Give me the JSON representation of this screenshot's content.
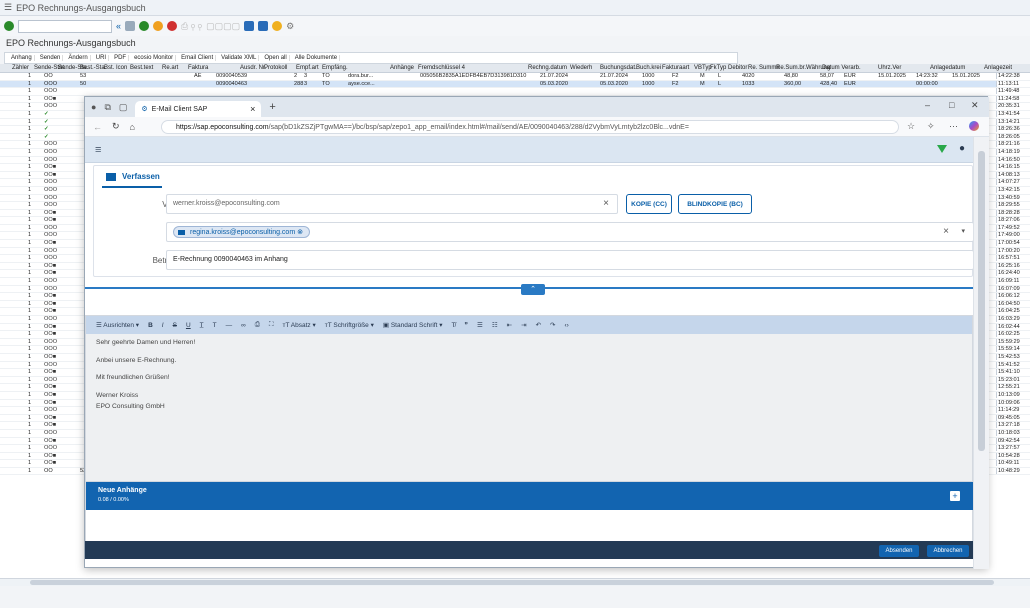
{
  "sap": {
    "window_title": "EPO Rechnungs-Ausgangsbuch",
    "page_title": "EPO Rechnungs-Ausgangsbuch",
    "toolbar_items": [
      "Anhang",
      "Senden",
      "Ändern",
      "URI",
      "PDF",
      "ecosio Monitor",
      "Email Client",
      "Validate XML",
      "Open all",
      "Alle Dokumente"
    ],
    "columns": [
      "Zähler",
      "Sende-Stat.",
      "Sende-Sta.",
      "Best.-Sta.",
      "Bst. Icon",
      "Best.text",
      "Re.art",
      "Faktura",
      "Ausdr. Nr.",
      "Protokoll",
      "Empf.art",
      "Empfäng.",
      "Anhänge",
      "Fremdschlüssel 4",
      "Rechng.datum",
      "Wiederh",
      "Buchungsdat.",
      "Buch.krei",
      "Fakturaart",
      "VBTyp",
      "FkTyp",
      "Debitor",
      "Re. Summe",
      "Re.Sum.br.",
      "Währung",
      "Datum Verarb.",
      "Uhrz.Ver",
      "Anlagedatum",
      "Anlagezeit"
    ],
    "rows": [
      {
        "z": "1",
        "s": "OO",
        "a": "53",
        "ar": "AE",
        "f": "0090040539",
        "n": "2",
        "p": "3",
        "e": "TO",
        "em": "dora.bur...",
        "k": "005056B2835A1EDFB4EB7D313981D310",
        "rd": "21.07.2024",
        "bd": "21.07.2024",
        "bk": "1000",
        "fa": "F2",
        "vb": "M",
        "fk": "L",
        "d": "4020",
        "rs": "48,80",
        "rb": "58,07",
        "w": "EUR",
        "dv": "15.01.2025",
        "uv": "14:23:32",
        "ad": "15.01.2025",
        "t": "14:22:38"
      },
      {
        "z": "1",
        "s": "OOO",
        "a": "50",
        "ar": "",
        "f": "0090040463",
        "n": "288",
        "p": "3",
        "e": "TO",
        "em": "ayse.cce...",
        "k": "",
        "rd": "05.03.2020",
        "bd": "05.03.2020",
        "bk": "1000",
        "fa": "F2",
        "vb": "M",
        "fk": "L",
        "d": "1033",
        "rs": "360,00",
        "rb": "428,40",
        "w": "EUR",
        "dv": "",
        "uv": "00:00:00",
        "ad": "",
        "t": "11:13:11"
      }
    ],
    "bottom_rows": [
      {
        "z": "1",
        "s": "OO",
        "a": "53",
        "n": "249",
        "p": "3",
        "e": "TO",
        "em": "customer...",
        "k": "005056B2835A1EDFA7892BF46CB3A96B",
        "rd": "05.03.2020",
        "bd": "05.03.2020",
        "bk": "1000",
        "fa": "F2",
        "vb": "M",
        "fk": "L",
        "d": "1033",
        "rs": "360,00",
        "rb": "428,40",
        "w": "EUR",
        "dv": "06.11.2024",
        "uv": "15:14:05",
        "t": "10:48:29"
      }
    ],
    "time_column": [
      "11:49:48",
      "11:24:58",
      "20:35:31",
      "13:41:54",
      "13:14:21",
      "18:26:36",
      "18:26:05",
      "18:21:16",
      "14:18:19",
      "14:16:50",
      "14:16:15",
      "14:08:13",
      "14:07:27",
      "13:42:15",
      "13:40:59",
      "18:29:55",
      "18:28:28",
      "18:27:06",
      "17:49:52",
      "17:49:00",
      "17:00:54",
      "17:00:20",
      "16:57:51",
      "16:25:16",
      "16:24:40",
      "16:09:11",
      "16:07:09",
      "16:06:12",
      "16:04:50",
      "16:04:25",
      "16:03:29",
      "16:02:44",
      "16:02:25",
      "15:59:29",
      "15:59:14",
      "15:42:53",
      "15:41:52",
      "15:41:10",
      "15:23:01",
      "12:55:21",
      "10:13:09",
      "10:09:06",
      "11:14:29",
      "09:45:05",
      "13:27:18",
      "10:18:03",
      "09:42:54",
      "13:27:57",
      "10:54:28",
      "10:49:11"
    ],
    "status_pattern": [
      "OOO",
      "OO",
      "OOO",
      "OK",
      "OK",
      "OK",
      "OK",
      "OOO",
      "OOO",
      "OOO",
      "OO",
      "OO",
      "OOO",
      "OOO",
      "OOO",
      "OOO",
      "OO",
      "OO",
      "OOO",
      "OOO",
      "OO",
      "OOO",
      "OOO",
      "OO",
      "OO",
      "OOO",
      "OOO",
      "OO",
      "OO",
      "OO",
      "OOO",
      "OO",
      "OO",
      "OOO",
      "OOO",
      "OO",
      "OOO",
      "OO",
      "OOO",
      "OO",
      "OO",
      "OO",
      "OOO",
      "OO",
      "OO",
      "OOO",
      "OO",
      "OOO",
      "OO",
      "OO",
      "OO"
    ]
  },
  "browser": {
    "tab_title": "E-Mail Client SAP",
    "url_host": "https://sap.epoconsulting.com",
    "url_path": "/sap(bD1kZSZjPTgwMA==)/bc/bsp/sap/zepo1_app_email/index.html#/mail/send/AE/0090040463/288/d2VybmVyLmtyb2lzc0Blc...vdnE=",
    "window_min": "–",
    "window_max": "□",
    "window_close": "✕"
  },
  "compose": {
    "tab_label": "Verfassen",
    "from_label": "Von",
    "from_value": "werner.kroiss@epoconsulting.com",
    "cc_button": "KOPIE (CC)",
    "bcc_button": "BLINDKOPIE (BC)",
    "to_label": "An",
    "to_chip": "regina.kroiss@epoconsulting.com",
    "subject_label": "Betreff",
    "subject_value": "E-Rechnung 0090040463 im Anhang"
  },
  "editor": {
    "toolbar": [
      "Ausrichten",
      "B",
      "I",
      "S",
      "U",
      "T",
      "Absatz",
      "Schriftgröße",
      "Standard Schrift"
    ],
    "lines": [
      "Sehr geehrte Damen und Herren!",
      "Anbei unsere E-Rechnung.",
      "Mit freundlichen Grüßen!",
      "Werner Kroiss",
      "EPO Consulting GmbH"
    ]
  },
  "attachments": {
    "title": "Neue Anhänge",
    "size": "0.08 / 0.00%"
  },
  "footer": {
    "send": "Absenden",
    "cancel": "Abbrechen"
  },
  "colors": {
    "sap_blue": "#1264b0",
    "header_bg": "#dbe6f2",
    "footer_bg": "#233a55",
    "ok_green": "#2a8a2a"
  }
}
